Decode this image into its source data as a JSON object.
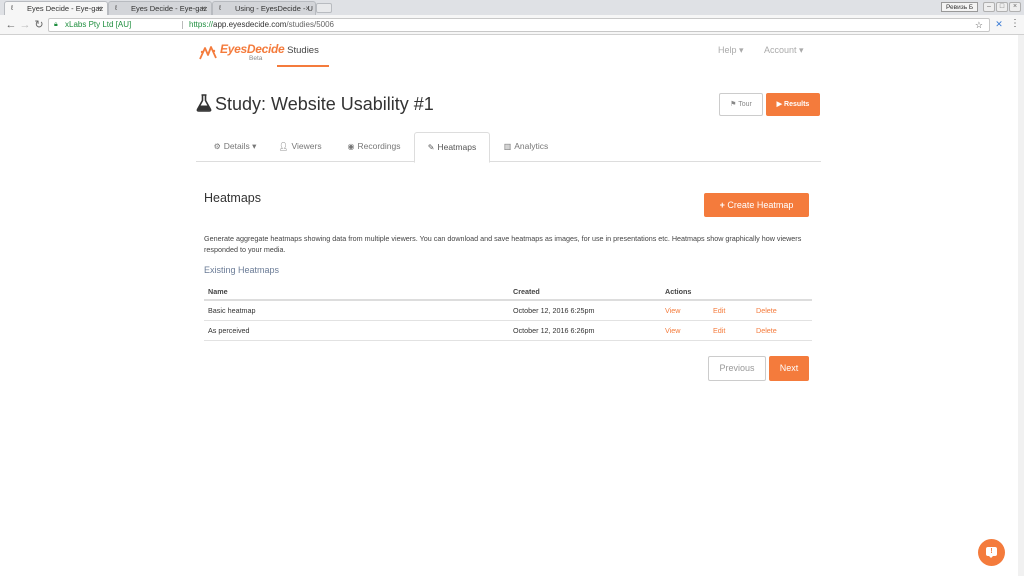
{
  "browser": {
    "tabs": [
      {
        "label": "Eyes Decide - Eye-gaz",
        "active": true
      },
      {
        "label": "Eyes Decide - Eye-gaz",
        "active": false
      },
      {
        "label": "Using - EyesDecide - U",
        "active": false
      }
    ],
    "profile_label": "Ревизь Б",
    "ev_label": "xLabs Pty Ltd [AU]",
    "url_scheme": "https://",
    "url_host": "app.eyesdecide.com",
    "url_path": "/studies/5006"
  },
  "app": {
    "logo_text": "EyesDecide",
    "logo_beta": "Beta",
    "nav_studies": "Studies",
    "nav_help": "Help ▾",
    "nav_account": "Account ▾",
    "accent_color": "#f47b3c"
  },
  "study": {
    "title": "Study: Website Usability #1",
    "tour_label": "Tour",
    "results_label": "Results"
  },
  "tabs": [
    {
      "label": "Details ▾",
      "icon": "gears-icon"
    },
    {
      "label": "Viewers",
      "icon": "user-plus-icon"
    },
    {
      "label": "Recordings",
      "icon": "eye-icon"
    },
    {
      "label": "Heatmaps",
      "icon": "magic-wand-icon",
      "active": true
    },
    {
      "label": "Analytics",
      "icon": "bar-chart-icon"
    }
  ],
  "heatmaps": {
    "title": "Heatmaps",
    "create_label": "Create Heatmap",
    "description": "Generate aggregate heatmaps showing data from multiple viewers. You can download and save heatmaps as images, for use in presentations etc. Heatmaps show graphically how viewers responded to your media.",
    "existing_title": "Existing Heatmaps",
    "columns": {
      "name": "Name",
      "created": "Created",
      "actions": "Actions"
    },
    "rows": [
      {
        "name": "Basic heatmap",
        "created": "October 12, 2016 6:25pm",
        "view": "View",
        "edit": "Edit",
        "delete": "Delete"
      },
      {
        "name": "As perceived",
        "created": "October 12, 2016 6:26pm",
        "view": "View",
        "edit": "Edit",
        "delete": "Delete"
      }
    ],
    "prev_label": "Previous",
    "next_label": "Next"
  },
  "help_fab_glyph": "!"
}
